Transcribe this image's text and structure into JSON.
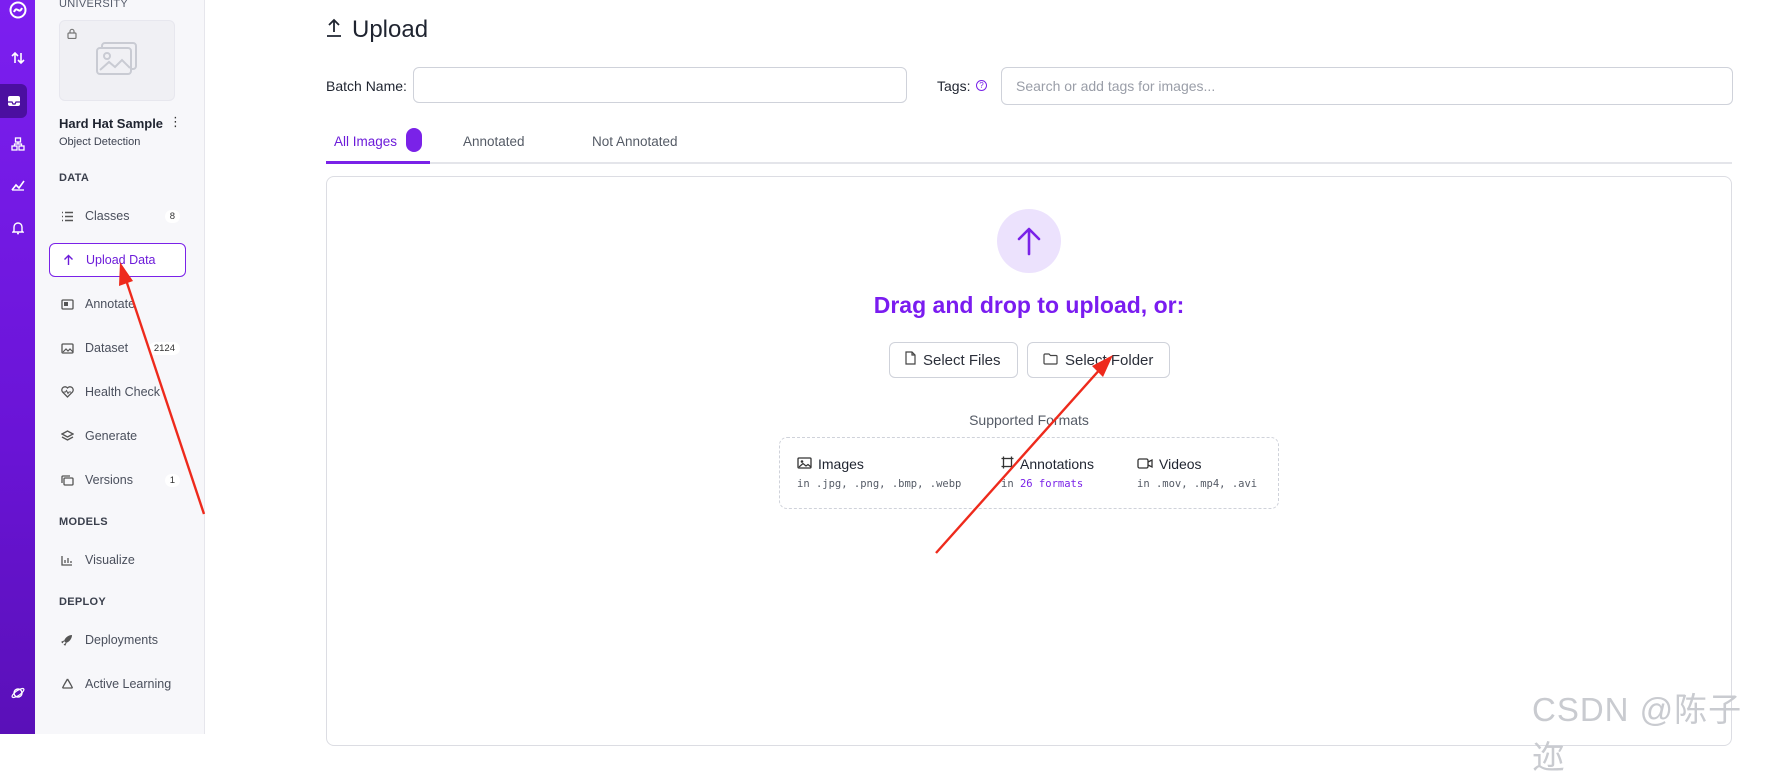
{
  "sidebar": {
    "workspace_label": "UNIVERSITY",
    "project_name": "Hard Hat Sample",
    "project_more": "⋮",
    "project_type": "Object Detection",
    "sections": {
      "data": "DATA",
      "models": "MODELS",
      "deploy": "DEPLOY"
    },
    "items": [
      {
        "label": "Classes",
        "badge": "8",
        "icon": "list-icon"
      },
      {
        "label": "Upload Data",
        "badge": "",
        "icon": "arrow-up-icon"
      },
      {
        "label": "Annotate",
        "badge": "",
        "icon": "annotate-icon"
      },
      {
        "label": "Dataset",
        "badge": "2124",
        "icon": "images-icon"
      },
      {
        "label": "Health Check",
        "badge": "",
        "icon": "heart-pulse-icon"
      },
      {
        "label": "Generate",
        "badge": "",
        "icon": "layers-icon"
      },
      {
        "label": "Versions",
        "badge": "1",
        "icon": "versions-icon"
      },
      {
        "label": "Visualize",
        "badge": "",
        "icon": "chart-icon"
      },
      {
        "label": "Deployments",
        "badge": "",
        "icon": "rocket-icon"
      },
      {
        "label": "Active Learning",
        "badge": "",
        "icon": "recycle-icon"
      }
    ]
  },
  "main": {
    "title": "Upload",
    "batch_label": "Batch Name:",
    "batch_value": "",
    "tags_label": "Tags:",
    "tags_help": "?",
    "tags_placeholder": "Search or add tags for images...",
    "tabs": [
      "All Images",
      "Annotated",
      "Not Annotated"
    ],
    "drop_text": "Drag and drop to upload, or:",
    "select_files": "Select Files",
    "select_folder": "Select Folder",
    "formats_title": "Supported Formats",
    "formats": [
      {
        "name": "Images",
        "sub": "in .jpg, .png, .bmp, .webp"
      },
      {
        "name": "Annotations",
        "sub_prefix": "in ",
        "sub_link": "26 formats"
      },
      {
        "name": "Videos",
        "sub": "in .mov, .mp4, .avi"
      }
    ]
  },
  "watermark": "CSDN @陈子迩",
  "colors": {
    "brand": "#7a22e8",
    "rail": "#6a14d6",
    "annotation_arrow": "#ee2a1c"
  }
}
